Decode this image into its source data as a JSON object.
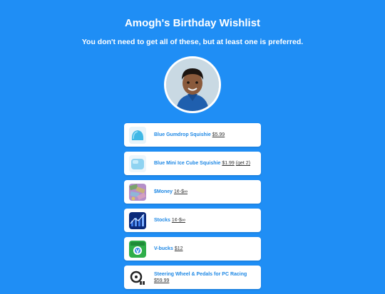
{
  "header": {
    "title": "Amogh's Birthday Wishlist",
    "subtitle": "You don't need to get all of these, but at least one is preferred."
  },
  "wishlist": {
    "items": [
      {
        "name": "Blue Gumdrop Squishie",
        "price": "$5.99",
        "note": "",
        "icon": "blue-gumdrop-squishie-icon"
      },
      {
        "name": "Blue Mini Ice Cube Squishie",
        "price": "$1.99",
        "note": "(get 2)",
        "icon": "ice-cube-squishie-icon"
      },
      {
        "name": "$Money",
        "price": "1¢-$∞",
        "note": "",
        "icon": "money-icon"
      },
      {
        "name": "Stocks",
        "price": "1¢-$∞",
        "note": "",
        "icon": "stocks-icon"
      },
      {
        "name": "V-bucks",
        "price": "$12",
        "note": "",
        "icon": "vbucks-card-icon"
      },
      {
        "name": "Steering Wheel & Pedals for PC Racing",
        "price": "$59.99",
        "note": "",
        "icon": "steering-wheel-icon"
      }
    ]
  }
}
